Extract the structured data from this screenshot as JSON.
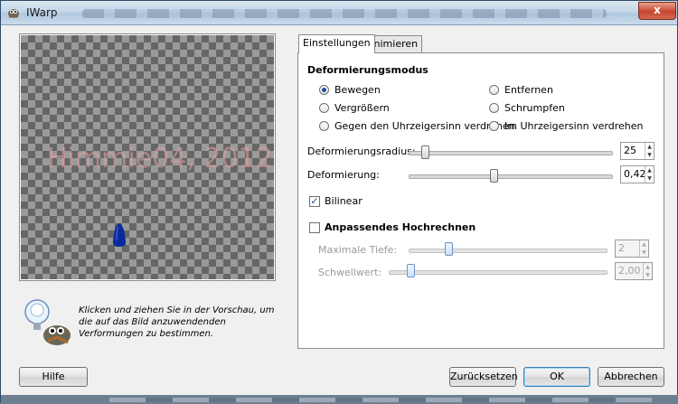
{
  "window": {
    "title": "IWarp",
    "close_label": "x"
  },
  "preview": {
    "watermark": "Himmie04, 2012",
    "info_text": "Klicken und ziehen Sie in der Vorschau, um die auf das Bild anzuwendenden Verformungen zu bestimmen."
  },
  "tabs": [
    {
      "label": "Einstellungen",
      "active": true
    },
    {
      "label": "Animieren",
      "active": false
    }
  ],
  "settings": {
    "mode_heading": "Deformierungsmodus",
    "modes": [
      {
        "label": "Bewegen",
        "selected": true
      },
      {
        "label": "Entfernen",
        "selected": false
      },
      {
        "label": "Vergrößern",
        "selected": false
      },
      {
        "label": "Schrumpfen",
        "selected": false
      },
      {
        "label": "Gegen den Uhrzeigersinn verdrehen",
        "selected": false
      },
      {
        "label": "Im Uhrzeigersinn verdrehen",
        "selected": false
      }
    ],
    "radius": {
      "label": "Deformierungsradius:",
      "value": "25",
      "fraction": 0.08
    },
    "amount": {
      "label": "Deformierung:",
      "value": "0,42",
      "fraction": 0.42
    },
    "bilinear": {
      "label": "Bilinear",
      "checked": true
    },
    "supersample": {
      "label": "Anpassendes Hochrechnen",
      "checked": false
    },
    "max_depth": {
      "label": "Maximale Tiefe:",
      "value": "2",
      "fraction": 0.2
    },
    "threshold": {
      "label": "Schwellwert:",
      "value": "2,00",
      "fraction": 0.1
    }
  },
  "buttons": {
    "help": "Hilfe",
    "reset": "Zurücksetzen",
    "ok": "OK",
    "cancel": "Abbrechen"
  },
  "colors": {
    "accent": "#1f4fa8",
    "blob": "#0b2a9e"
  }
}
